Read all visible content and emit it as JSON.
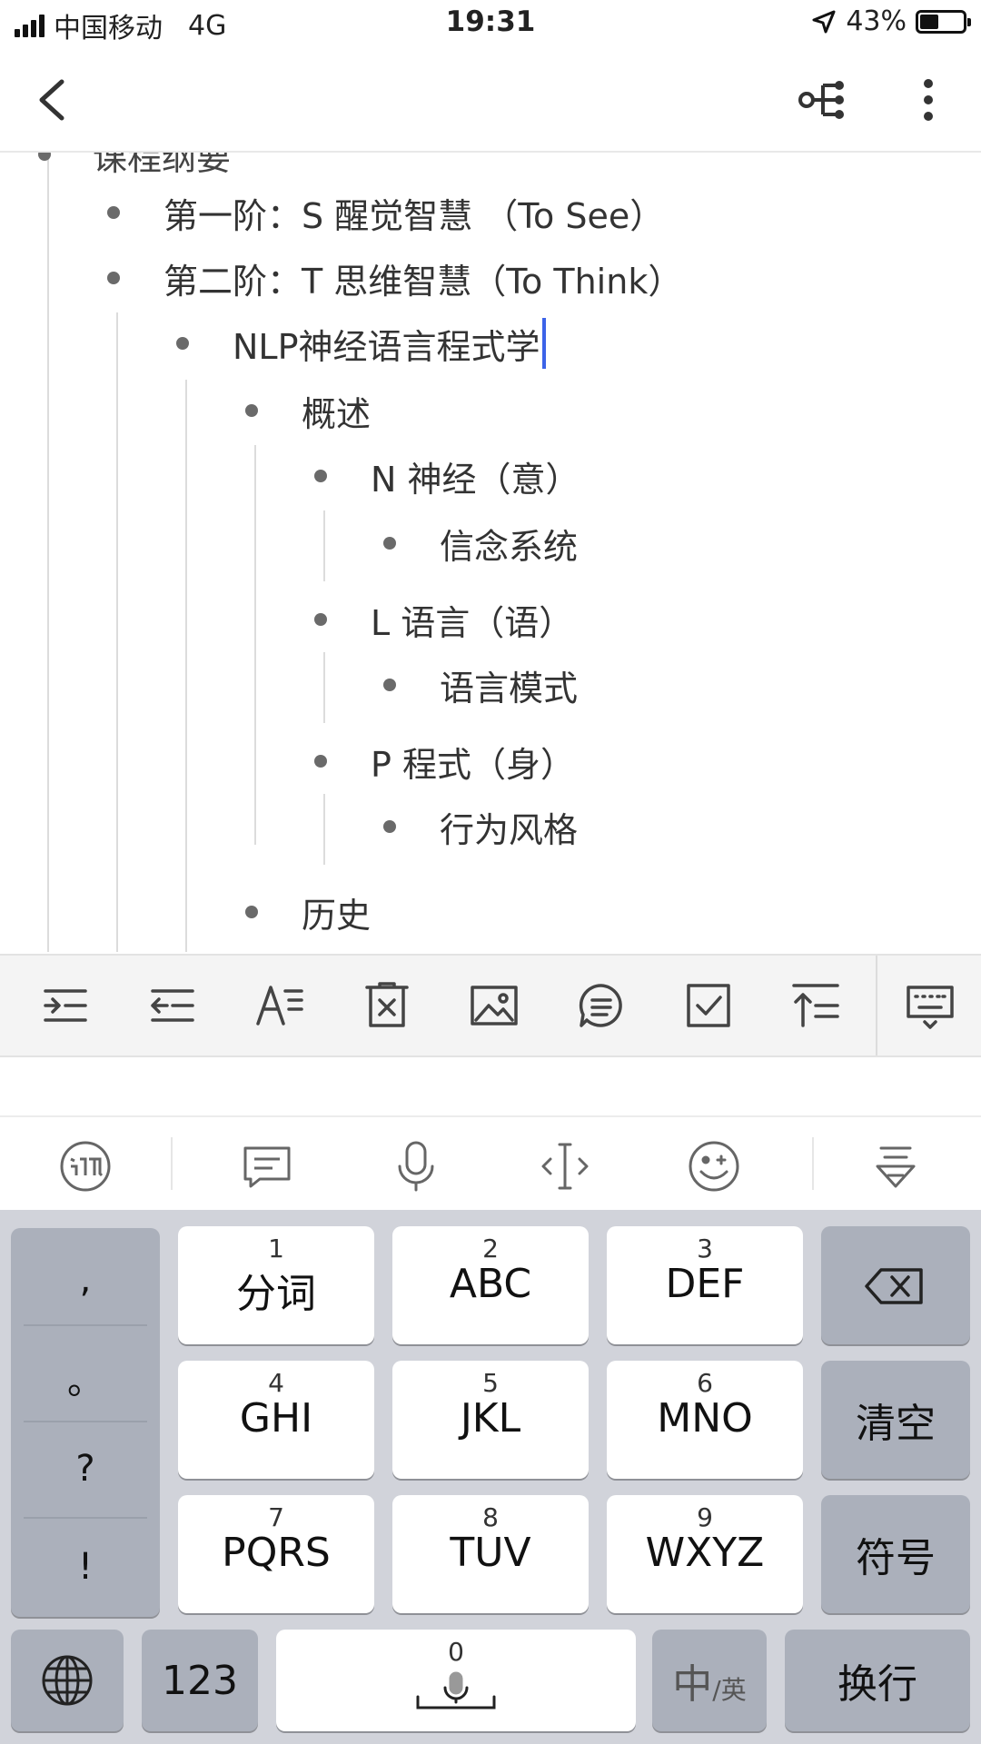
{
  "status_bar": {
    "carrier": "中国移动",
    "network": "4G",
    "time": "19:31",
    "battery_percent": "43%",
    "battery_level": 0.43
  },
  "nav": {
    "back_icon": "chevron-left-icon",
    "mindmap_icon": "mindmap-icon",
    "more_icon": "more-vertical-icon"
  },
  "outline": {
    "partial_top": "课程纲要",
    "items": [
      {
        "text": "第一阶：S 醒觉智慧 （To See）"
      },
      {
        "text": "第二阶：T 思维智慧（To Think）"
      },
      {
        "text": "NLP神经语言程式学"
      },
      {
        "text": "概述"
      },
      {
        "text": "N 神经（意）"
      },
      {
        "text": "信念系统"
      },
      {
        "text": "L 语言（语）"
      },
      {
        "text": "语言模式"
      },
      {
        "text": "P 程式（身）"
      },
      {
        "text": "行为风格"
      },
      {
        "text": "历史"
      }
    ]
  },
  "format_toolbar": {
    "icons": [
      "indent-icon",
      "outdent-icon",
      "text-format-icon",
      "delete-node-icon",
      "image-icon",
      "note-icon",
      "checkbox-icon",
      "move-up-icon",
      "hide-keyboard-icon"
    ]
  },
  "ime_bar": {
    "icons": [
      "ime-logo-icon",
      "message-icon",
      "microphone-icon",
      "cursor-move-icon",
      "emoji-icon",
      "collapse-keyboard-icon"
    ]
  },
  "keyboard": {
    "punctuation": [
      ",",
      "。",
      "?",
      "!"
    ],
    "keys": [
      {
        "num": "1",
        "label": "分词"
      },
      {
        "num": "2",
        "label": "ABC"
      },
      {
        "num": "3",
        "label": "DEF"
      },
      {
        "num": "4",
        "label": "GHI"
      },
      {
        "num": "5",
        "label": "JKL"
      },
      {
        "num": "6",
        "label": "MNO"
      },
      {
        "num": "7",
        "label": "PQRS"
      },
      {
        "num": "8",
        "label": "TUV"
      },
      {
        "num": "9",
        "label": "WXYZ"
      }
    ],
    "clear": "清空",
    "symbols": "符号",
    "numbers": "123",
    "space_num": "0",
    "lang_main": "中",
    "lang_alt": "/英",
    "enter": "换行"
  }
}
